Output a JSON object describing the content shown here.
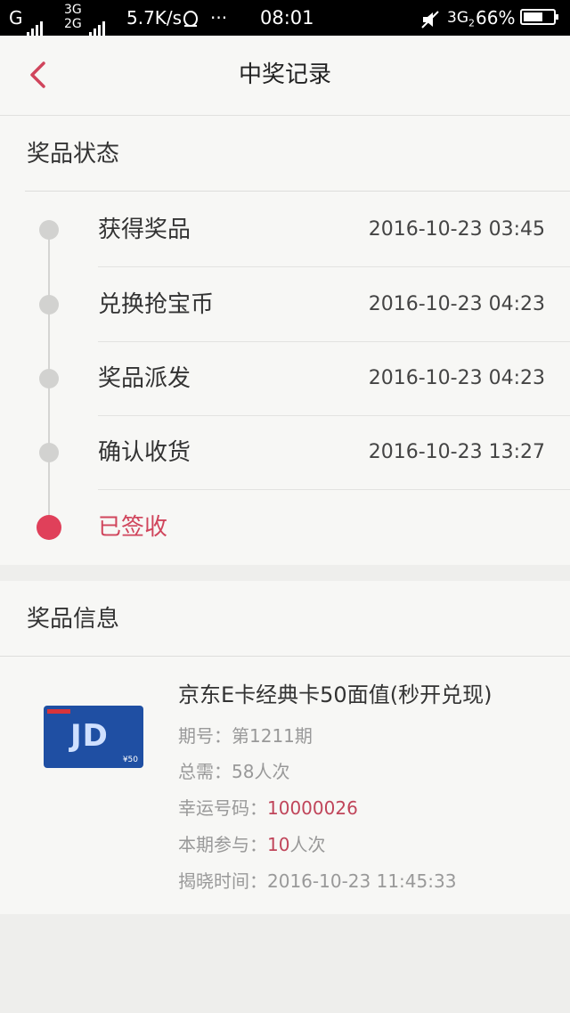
{
  "status_bar": {
    "carrier": "G",
    "network_top": "3G",
    "network_bottom": "2G",
    "speed": "5.7K/s",
    "dots": "···",
    "time": "08:01",
    "network_right": "3G",
    "network_right_sub": "2",
    "battery": "66%",
    "battery_level": 0.66
  },
  "header": {
    "title": "中奖记录"
  },
  "prize_status": {
    "section_title": "奖品状态",
    "steps": [
      {
        "label": "获得奖品",
        "time": "2016-10-23 03:45"
      },
      {
        "label": "兑换抢宝币",
        "time": "2016-10-23 04:23"
      },
      {
        "label": "奖品派发",
        "time": "2016-10-23 04:23"
      },
      {
        "label": "确认收货",
        "time": "2016-10-23 13:27"
      },
      {
        "label": "已签收",
        "time": ""
      }
    ]
  },
  "prize_info": {
    "section_title": "奖品信息",
    "name": "京东E卡经典卡50面值(秒开兑现)",
    "period_label": "期号：",
    "period_value": "第1211期",
    "total_label": "总需：",
    "total_value": "58人次",
    "lucky_label": "幸运号码：",
    "lucky_value": "10000026",
    "participate_label": "本期参与：",
    "participate_count": "10",
    "participate_unit": "人次",
    "reveal_label": "揭晓时间：",
    "reveal_time": "2016-10-23 11:45:33",
    "card_logo": "JD",
    "card_value": "¥50"
  },
  "colors": {
    "accent": "#e0405a",
    "background": "#eeeeec"
  }
}
